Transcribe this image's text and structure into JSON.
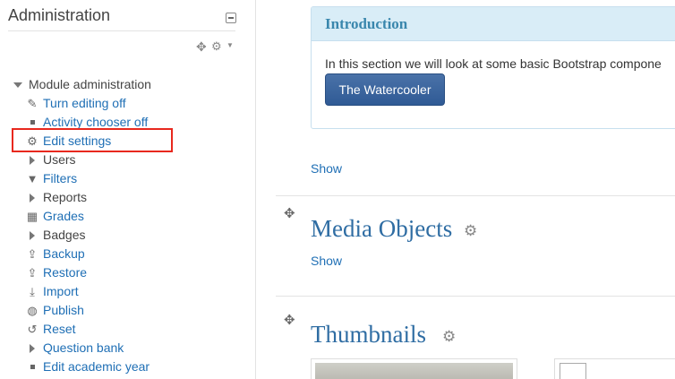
{
  "admin": {
    "title": "Administration",
    "items": [
      {
        "label": "Module administration",
        "icon": "expanded-triangle-icon"
      },
      {
        "label": "Turn editing off",
        "icon": "pencil-icon"
      },
      {
        "label": "Activity chooser off",
        "icon": "bullet-icon"
      },
      {
        "label": "Edit settings",
        "icon": "gear-icon"
      },
      {
        "label": "Users",
        "icon": "collapsed-triangle-icon"
      },
      {
        "label": "Filters",
        "icon": "filter-icon"
      },
      {
        "label": "Reports",
        "icon": "collapsed-triangle-icon"
      },
      {
        "label": "Grades",
        "icon": "grid-icon"
      },
      {
        "label": "Badges",
        "icon": "collapsed-triangle-icon"
      },
      {
        "label": "Backup",
        "icon": "upload-icon"
      },
      {
        "label": "Restore",
        "icon": "upload-icon"
      },
      {
        "label": "Import",
        "icon": "download-icon"
      },
      {
        "label": "Publish",
        "icon": "globe-icon"
      },
      {
        "label": "Reset",
        "icon": "reset-icon"
      },
      {
        "label": "Question bank",
        "icon": "collapsed-triangle-icon"
      },
      {
        "label": "Edit academic year",
        "icon": "bullet-icon"
      }
    ]
  },
  "intro": {
    "heading": "Introduction",
    "text": "In this section we will look at some basic Bootstrap compone",
    "button": "The Watercooler"
  },
  "sections": {
    "show": "Show",
    "media_title": "Media Objects",
    "thumbnails_title": "Thumbnails",
    "broken_image_text": "..."
  },
  "colors": {
    "link": "#1f6fb5",
    "highlight": "#e8281e",
    "intro_header_bg": "#d9edf7",
    "button": "#3b659e"
  }
}
